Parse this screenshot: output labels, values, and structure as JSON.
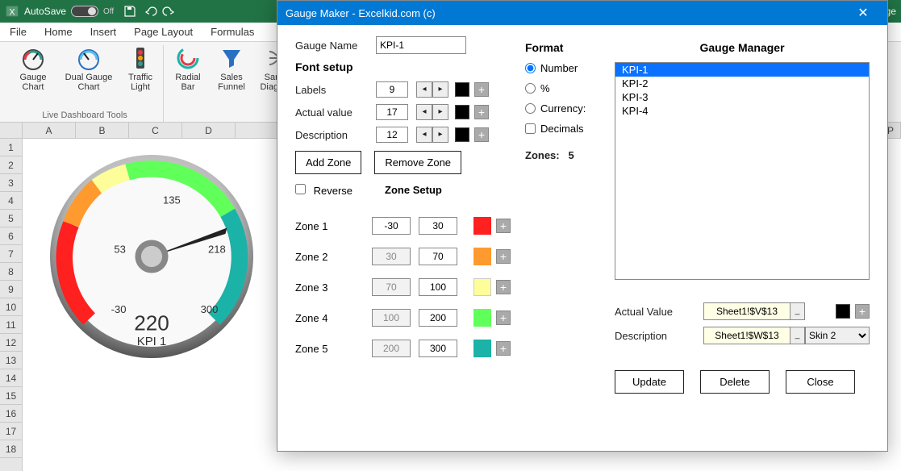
{
  "titlebar": {
    "autosave": "AutoSave",
    "off": "Off",
    "docname": "Gauge"
  },
  "tabs": {
    "file": "File",
    "home": "Home",
    "insert": "Insert",
    "page_layout": "Page Layout",
    "formulas": "Formulas"
  },
  "ribbon": {
    "gauge_chart": "Gauge\nChart",
    "dual_gauge_chart": "Dual Gauge\nChart",
    "traffic_light": "Traffic\nLight",
    "radial_bar": "Radial\nBar",
    "sales_funnel": "Sales\nFunnel",
    "sankey": "Sankey\nDiagrams",
    "group_title": "Live Dashboard Tools"
  },
  "columns": [
    "A",
    "B",
    "C",
    "D"
  ],
  "far_col": "P",
  "rows": [
    "1",
    "2",
    "3",
    "4",
    "5",
    "6",
    "7",
    "8",
    "9",
    "10",
    "11",
    "12",
    "13",
    "14",
    "15",
    "16",
    "17",
    "18"
  ],
  "gauge": {
    "tick_top": "135",
    "tick_left": "53",
    "tick_min": "-30",
    "tick_max": "300",
    "needle": "218",
    "actual": "220",
    "desc": "KPI 1"
  },
  "dialog": {
    "title": "Gauge Maker - Excelkid.com (c)",
    "gauge_name_label": "Gauge Name",
    "gauge_name_value": "KPI-1",
    "font_setup": "Font setup",
    "labels_label": "Labels",
    "labels_value": "9",
    "actual_label": "Actual value",
    "actual_value": "17",
    "desc_label": "Description",
    "desc_value": "12",
    "add_zone": "Add Zone",
    "remove_zone": "Remove Zone",
    "reverse": "Reverse",
    "zone_setup": "Zone Setup",
    "zones": [
      {
        "label": "Zone 1",
        "from": "-30",
        "from_disabled": false,
        "to": "30"
      },
      {
        "label": "Zone 2",
        "from": "30",
        "from_disabled": true,
        "to": "70"
      },
      {
        "label": "Zone 3",
        "from": "70",
        "from_disabled": true,
        "to": "100"
      },
      {
        "label": "Zone 4",
        "from": "100",
        "from_disabled": true,
        "to": "200"
      },
      {
        "label": "Zone 5",
        "from": "200",
        "from_disabled": true,
        "to": "300"
      }
    ],
    "format_h": "Format",
    "fmt_number": "Number",
    "fmt_percent": "%",
    "fmt_currency": "Currency:",
    "decimals": "Decimals",
    "zones_label": "Zones:",
    "zones_count": "5",
    "manager_h": "Gauge Manager",
    "kpi_list": [
      "KPI-1",
      "KPI-2",
      "KPI-3",
      "KPI-4"
    ],
    "selected_kpi": 0,
    "actual_value_label": "Actual Value",
    "actual_value_ref": "Sheet1!$V$13",
    "description_label": "Description",
    "description_ref": "Sheet1!$W$13",
    "skin": "Skin 2",
    "update": "Update",
    "delete": "Delete",
    "close": "Close"
  },
  "chart_data": {
    "type": "gauge",
    "title": "KPI 1",
    "value": 220,
    "min": -30,
    "max": 300,
    "ticks": [
      -30,
      53,
      135,
      218,
      300
    ],
    "zones": [
      {
        "from": -30,
        "to": 30,
        "color": "#ff2020"
      },
      {
        "from": 30,
        "to": 70,
        "color": "#ff9a2f"
      },
      {
        "from": 70,
        "to": 100,
        "color": "#fdfd9a"
      },
      {
        "from": 100,
        "to": 200,
        "color": "#60ff5a"
      },
      {
        "from": 200,
        "to": 300,
        "color": "#1bb2a8"
      }
    ]
  }
}
